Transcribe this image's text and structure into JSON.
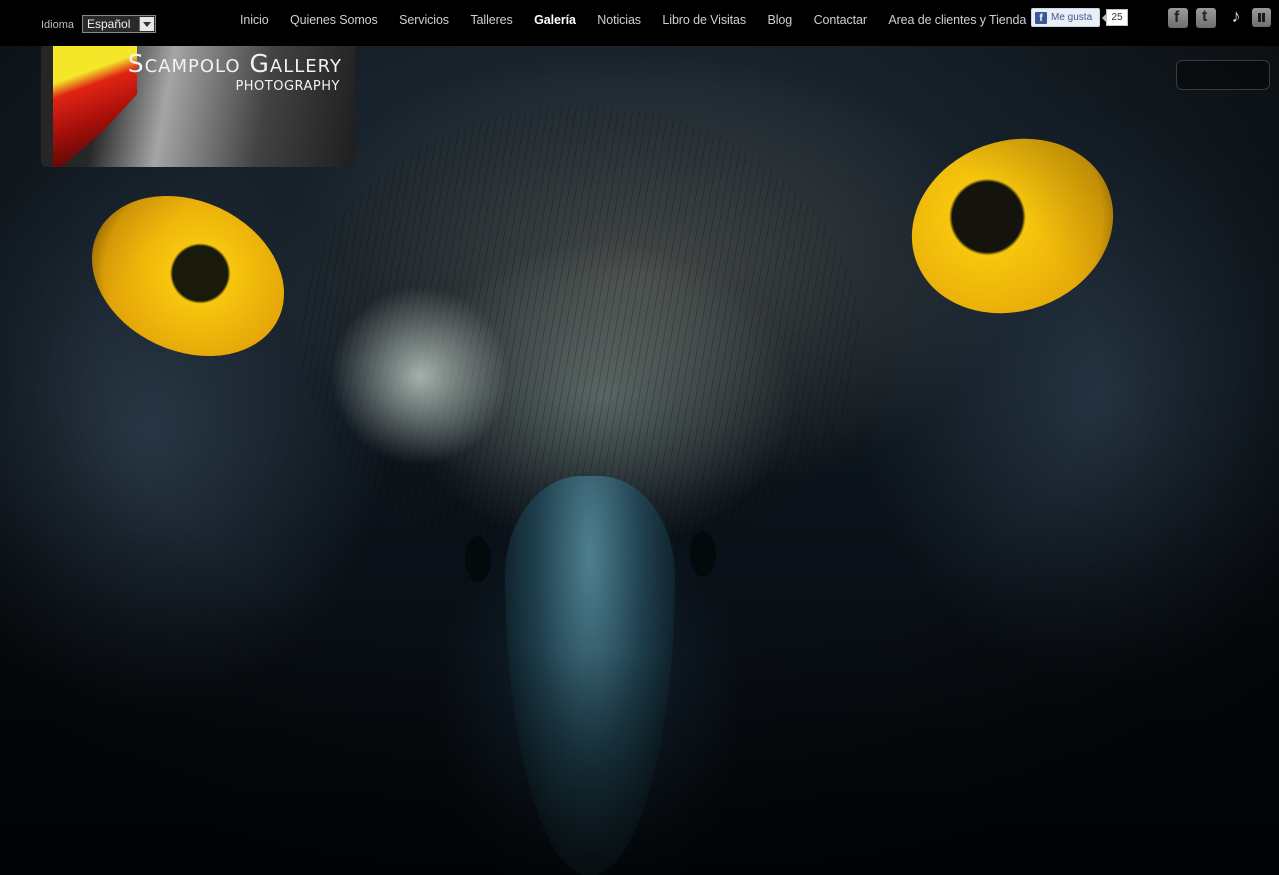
{
  "language": {
    "label": "Idioma",
    "selected": "Español"
  },
  "nav": {
    "items": [
      {
        "label": "Inicio"
      },
      {
        "label": "Quienes Somos"
      },
      {
        "label": "Servicios"
      },
      {
        "label": "Talleres"
      },
      {
        "label": "Galería",
        "active": true
      },
      {
        "label": "Noticias"
      },
      {
        "label": "Libro de Visitas"
      },
      {
        "label": "Blog"
      },
      {
        "label": "Contactar"
      },
      {
        "label": "Area de clientes y Tienda"
      }
    ]
  },
  "facebook": {
    "like_label": "Me gusta",
    "count": "25"
  },
  "social": {
    "icons": [
      "facebook-icon",
      "twitter-icon",
      "music-note-icon",
      "pause-icon"
    ]
  },
  "logo": {
    "title": "Scampolo Gallery",
    "subtitle": "PHOTOGRAPHY"
  },
  "colors": {
    "background": "#000000",
    "nav_text": "#cfcfcf",
    "nav_active": "#ffffff",
    "eye_yellow": "#f7c60d"
  }
}
